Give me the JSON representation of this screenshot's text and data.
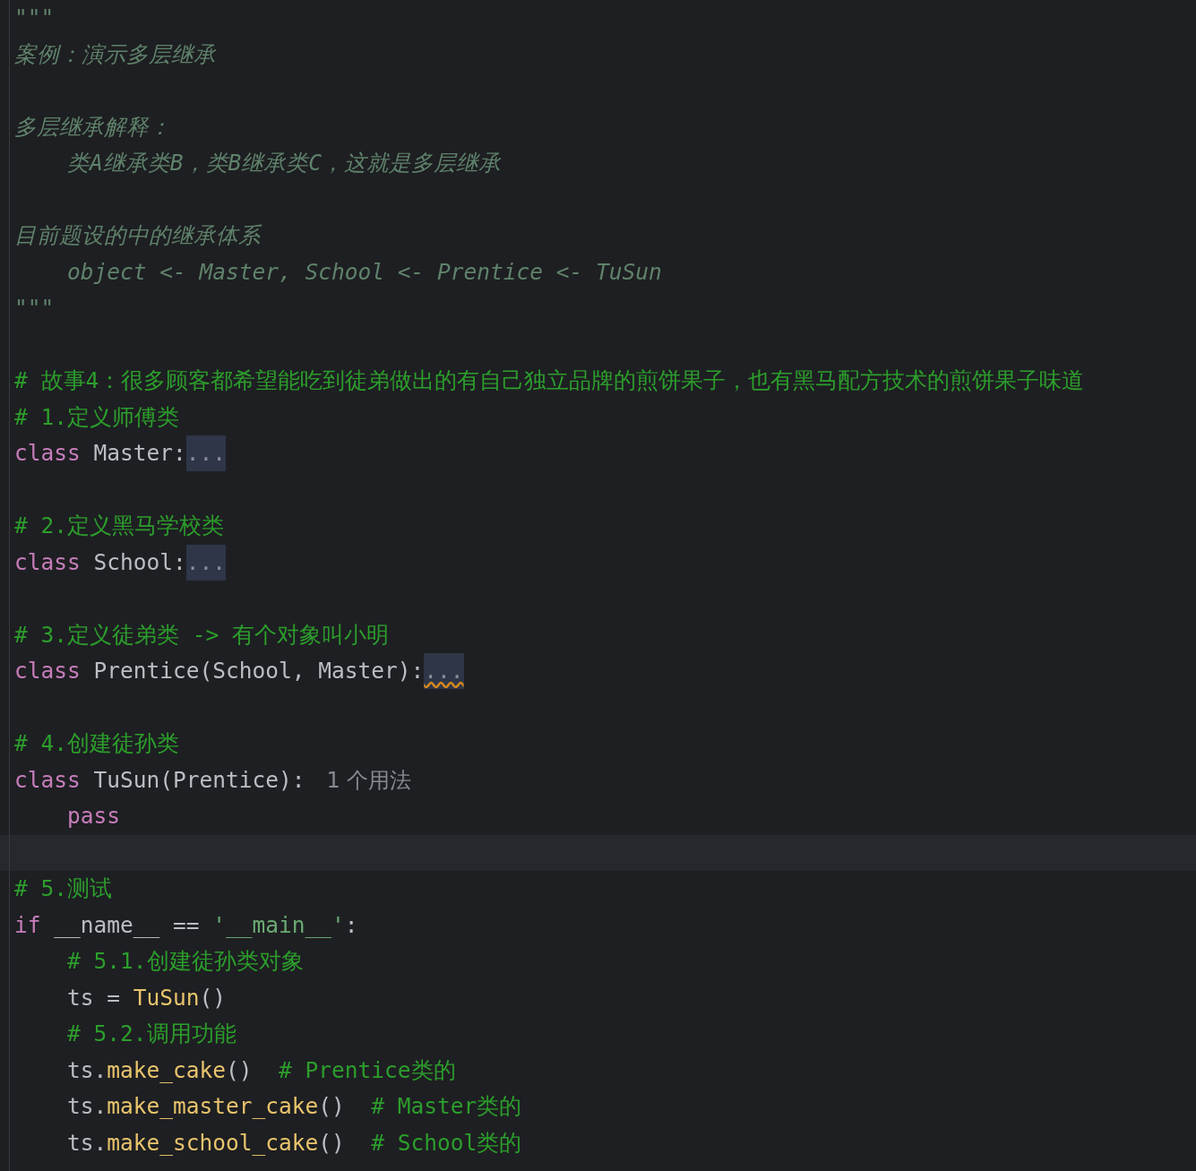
{
  "editor": {
    "lines": [
      {
        "current": false,
        "tokens": [
          {
            "kind": "doc",
            "text": "\"\"\""
          }
        ]
      },
      {
        "current": false,
        "tokens": [
          {
            "kind": "doc",
            "text": "案例：演示多层继承"
          }
        ]
      },
      {
        "current": false
      },
      {
        "current": false,
        "tokens": [
          {
            "kind": "doc",
            "text": "多层继承解释："
          }
        ]
      },
      {
        "current": false,
        "tokens": [
          {
            "kind": "doc",
            "text": "    类A继承类B，类B继承类C，这就是多层继承"
          }
        ]
      },
      {
        "current": false
      },
      {
        "current": false,
        "tokens": [
          {
            "kind": "doc",
            "text": "目前题设的中的继承体系"
          }
        ]
      },
      {
        "current": false,
        "tokens": [
          {
            "kind": "doc",
            "text": "    object <- Master, School <- Prentice <- TuSun"
          }
        ]
      },
      {
        "current": false,
        "tokens": [
          {
            "kind": "doc",
            "text": "\"\"\""
          }
        ]
      },
      {
        "current": false
      },
      {
        "current": false,
        "tokens": [
          {
            "kind": "comment",
            "text": "# 故事4：很多顾客都希望能吃到徒弟做出的有自己独立品牌的煎饼果子，也有黑马配方技术的煎饼果子味道"
          }
        ]
      },
      {
        "current": false,
        "tokens": [
          {
            "kind": "comment",
            "text": "# 1.定义师傅类"
          }
        ]
      },
      {
        "current": false,
        "tokens": [
          {
            "kind": "keyword",
            "text": "class"
          },
          {
            "kind": "plain",
            "text": " Master:"
          },
          {
            "kind": "fold",
            "text": "...",
            "warning": false
          }
        ]
      },
      {
        "current": false
      },
      {
        "current": false,
        "tokens": [
          {
            "kind": "comment",
            "text": "# 2.定义黑马学校类"
          }
        ]
      },
      {
        "current": false,
        "tokens": [
          {
            "kind": "keyword",
            "text": "class"
          },
          {
            "kind": "plain",
            "text": " School:"
          },
          {
            "kind": "fold",
            "text": "...",
            "warning": false
          }
        ]
      },
      {
        "current": false
      },
      {
        "current": false,
        "tokens": [
          {
            "kind": "comment",
            "text": "# 3.定义徒弟类 -> 有个对象叫小明"
          }
        ]
      },
      {
        "current": false,
        "tokens": [
          {
            "kind": "keyword",
            "text": "class"
          },
          {
            "kind": "plain",
            "text": " Prentice(School, Master):"
          },
          {
            "kind": "fold",
            "text": "...",
            "warning": true
          }
        ]
      },
      {
        "current": false
      },
      {
        "current": false,
        "tokens": [
          {
            "kind": "comment",
            "text": "# 4.创建徒孙类"
          }
        ]
      },
      {
        "current": false,
        "tokens": [
          {
            "kind": "keyword",
            "text": "class"
          },
          {
            "kind": "plain",
            "text": " TuSun(Prentice):"
          },
          {
            "kind": "hint",
            "text": "1 个用法"
          }
        ]
      },
      {
        "current": false,
        "tokens": [
          {
            "kind": "keyword",
            "text": "    pass"
          }
        ]
      },
      {
        "current": true
      },
      {
        "current": false,
        "tokens": [
          {
            "kind": "comment",
            "text": "# 5.测试"
          }
        ]
      },
      {
        "current": false,
        "tokens": [
          {
            "kind": "keyword",
            "text": "if"
          },
          {
            "kind": "plain",
            "text": " __name__ == "
          },
          {
            "kind": "string",
            "text": "'__main__'"
          },
          {
            "kind": "plain",
            "text": ":"
          }
        ]
      },
      {
        "current": false,
        "tokens": [
          {
            "kind": "comment",
            "text": "    # 5.1.创建徒孙类对象"
          }
        ]
      },
      {
        "current": false,
        "tokens": [
          {
            "kind": "plain",
            "text": "    ts = "
          },
          {
            "kind": "func",
            "text": "TuSun"
          },
          {
            "kind": "plain",
            "text": "()"
          }
        ]
      },
      {
        "current": false,
        "tokens": [
          {
            "kind": "comment",
            "text": "    # 5.2.调用功能"
          }
        ]
      },
      {
        "current": false,
        "tokens": [
          {
            "kind": "plain",
            "text": "    ts."
          },
          {
            "kind": "func",
            "text": "make_cake"
          },
          {
            "kind": "plain",
            "text": "()"
          },
          {
            "kind": "comment",
            "text": "  # Prentice类的"
          }
        ]
      },
      {
        "current": false,
        "tokens": [
          {
            "kind": "plain",
            "text": "    ts."
          },
          {
            "kind": "func",
            "text": "make_master_cake"
          },
          {
            "kind": "plain",
            "text": "()"
          },
          {
            "kind": "comment",
            "text": "  # Master类的"
          }
        ]
      },
      {
        "current": false,
        "tokens": [
          {
            "kind": "plain",
            "text": "    ts."
          },
          {
            "kind": "func",
            "text": "make_school_cake"
          },
          {
            "kind": "plain",
            "text": "()"
          },
          {
            "kind": "comment",
            "text": "  # School类的"
          }
        ]
      }
    ]
  }
}
